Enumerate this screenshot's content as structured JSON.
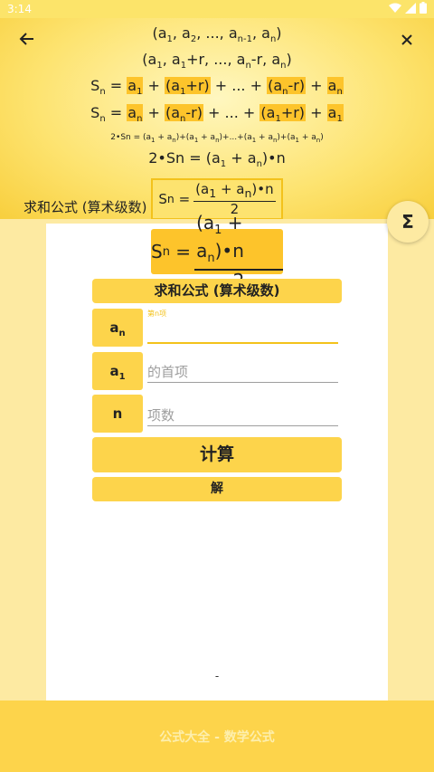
{
  "status_bar": {
    "time": "3:14",
    "wifi_icon": "wifi-icon",
    "signal_icon": "signal-icon",
    "battery_icon": "battery-icon"
  },
  "header": {
    "back_icon": "arrow-left-icon",
    "close_icon": "close-icon",
    "section_title": "求和公式 (算术级数)"
  },
  "sigma_button": "Σ",
  "card": {
    "calc_title": "求和公式 (算术级数)",
    "fields": [
      {
        "var_label": "a",
        "var_sub": "n",
        "floating_label": "第n项",
        "value": "",
        "placeholder": ""
      },
      {
        "var_label": "a",
        "var_sub": "1",
        "floating_label": "",
        "value": "",
        "placeholder": "的首项"
      },
      {
        "var_label": "n",
        "var_sub": "",
        "floating_label": "",
        "value": "",
        "placeholder": "项数"
      }
    ],
    "calc_button": "计算",
    "solve_button": "解",
    "result": "-"
  },
  "footer": {
    "text": "公式大全 - 数学公式"
  },
  "colors": {
    "accent": "#fdd44b",
    "accent_dark": "#fdc42b",
    "panel": "#fdeaa2",
    "header": "#fde36f"
  }
}
